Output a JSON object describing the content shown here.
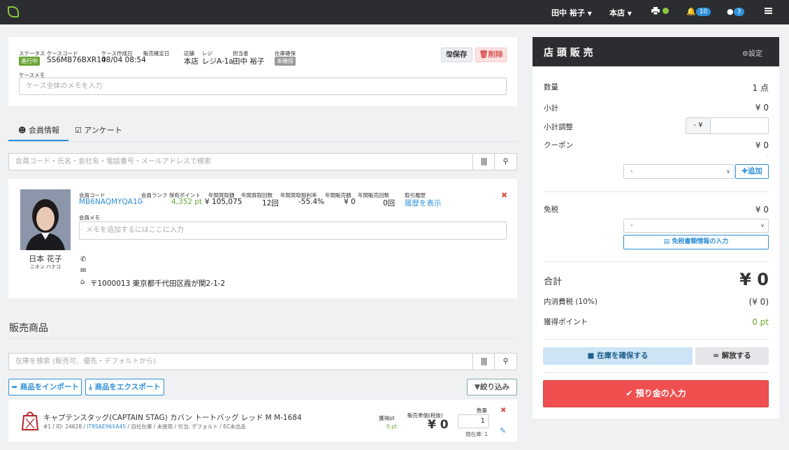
{
  "topbar": {
    "user": "田中 裕子",
    "store": "本店",
    "notifications": "10",
    "messages": "3"
  },
  "case": {
    "status_label": "ステータス",
    "status": "進行中",
    "code_label": "ケースコード",
    "code": "SS6MB76BXR14",
    "created_label": "ケース作成日",
    "created": "08/04 08:54",
    "sold_label": "販売確定日",
    "sold": "-",
    "store_label": "店舗",
    "store": "本店",
    "register_label": "レジ",
    "register": "レジA-1a",
    "staff_label": "担当者",
    "staff": "田中 裕子",
    "stock_label": "在庫確保",
    "stock": "未確保",
    "save": "保存",
    "delete": "削除",
    "memo_label": "ケースメモ",
    "memo_placeholder": "ケース全体のメモを入力"
  },
  "tabs": {
    "member": "会員情報",
    "survey": "アンケート"
  },
  "member_search": {
    "placeholder": "会員コード・氏名・会社名・電話番号・メールアドレスで検索"
  },
  "member": {
    "name": "日本 花子",
    "kana": "ニホン ハナコ",
    "code_label": "会員コード",
    "code": "MB6NAQMYQA10",
    "rank_label": "会員ランク",
    "rank": "-",
    "points_label": "保有ポイント",
    "points": "4,352 pt",
    "annual_buy_label": "年間買取額",
    "annual_buy": "¥ 105,075",
    "buy_count_label": "年間買取回数",
    "buy_count": "12回",
    "margin_label": "年間買取粗利率",
    "margin": "-55.4%",
    "annual_sale_label": "年間販売額",
    "annual_sale": "¥ 0",
    "sale_count_label": "年間販売回数",
    "sale_count": "0回",
    "history_label": "取引履歴",
    "history_link": "履歴を表示",
    "memo_label": "会員メモ",
    "memo_placeholder": "メモを追加するにはここに入力",
    "address": "〒1000013 東京都千代田区霞が関2-1-2"
  },
  "products": {
    "heading": "販売商品",
    "search_placeholder": "在庫を検索 (販売可、優先・デフォルトから)",
    "import": "商品をインポート",
    "export": "商品をエクスポート",
    "filter": "絞り込み",
    "items": [
      {
        "name": "キャプテンスタッグ(CAPTAIN STAG) カバン トートバッグ レッド M M-1684",
        "meta_prefix": "#1 / ID: 24628 / ",
        "meta_link": "IT8SAE96XA45",
        "meta_suffix": " / 自社在庫 / 未使用 / 引当: デフォルト / EC未出品",
        "points_label": "獲得pt",
        "points": "0 pt",
        "price_label": "販売単価(税抜)",
        "price": "¥ 0",
        "qty_label": "数量",
        "qty": "1",
        "stock": "現在庫: 1"
      }
    ]
  },
  "pos": {
    "title": "店 頭 販 売",
    "settings": "設定",
    "qty_label": "数量",
    "qty": "1 点",
    "subtotal_label": "小計",
    "subtotal": "¥ 0",
    "adjust_label": "小計調整",
    "adjust_prefix": "- ¥",
    "coupon_label": "クーポン",
    "coupon": "¥ 0",
    "coupon_sub": "-",
    "coupon_select": "-",
    "add": "追加",
    "taxfree_label": "免税",
    "taxfree": "¥ 0",
    "taxfree_select": "-",
    "taxfree_btn": "免税書類情報の入力",
    "total_label": "合計",
    "total": "¥ 0",
    "tax_label": "内消費税 (10%)",
    "tax": "(¥ 0)",
    "earn_label": "獲得ポイント",
    "earn": "0 pt",
    "reserve": "在庫を確保する",
    "release": "解放する",
    "deposit": "預り金の入力"
  },
  "colors": {
    "accent": "#2f8fd8",
    "danger": "#e84c4c",
    "green": "#6aa535",
    "dark": "#2b2d30"
  }
}
